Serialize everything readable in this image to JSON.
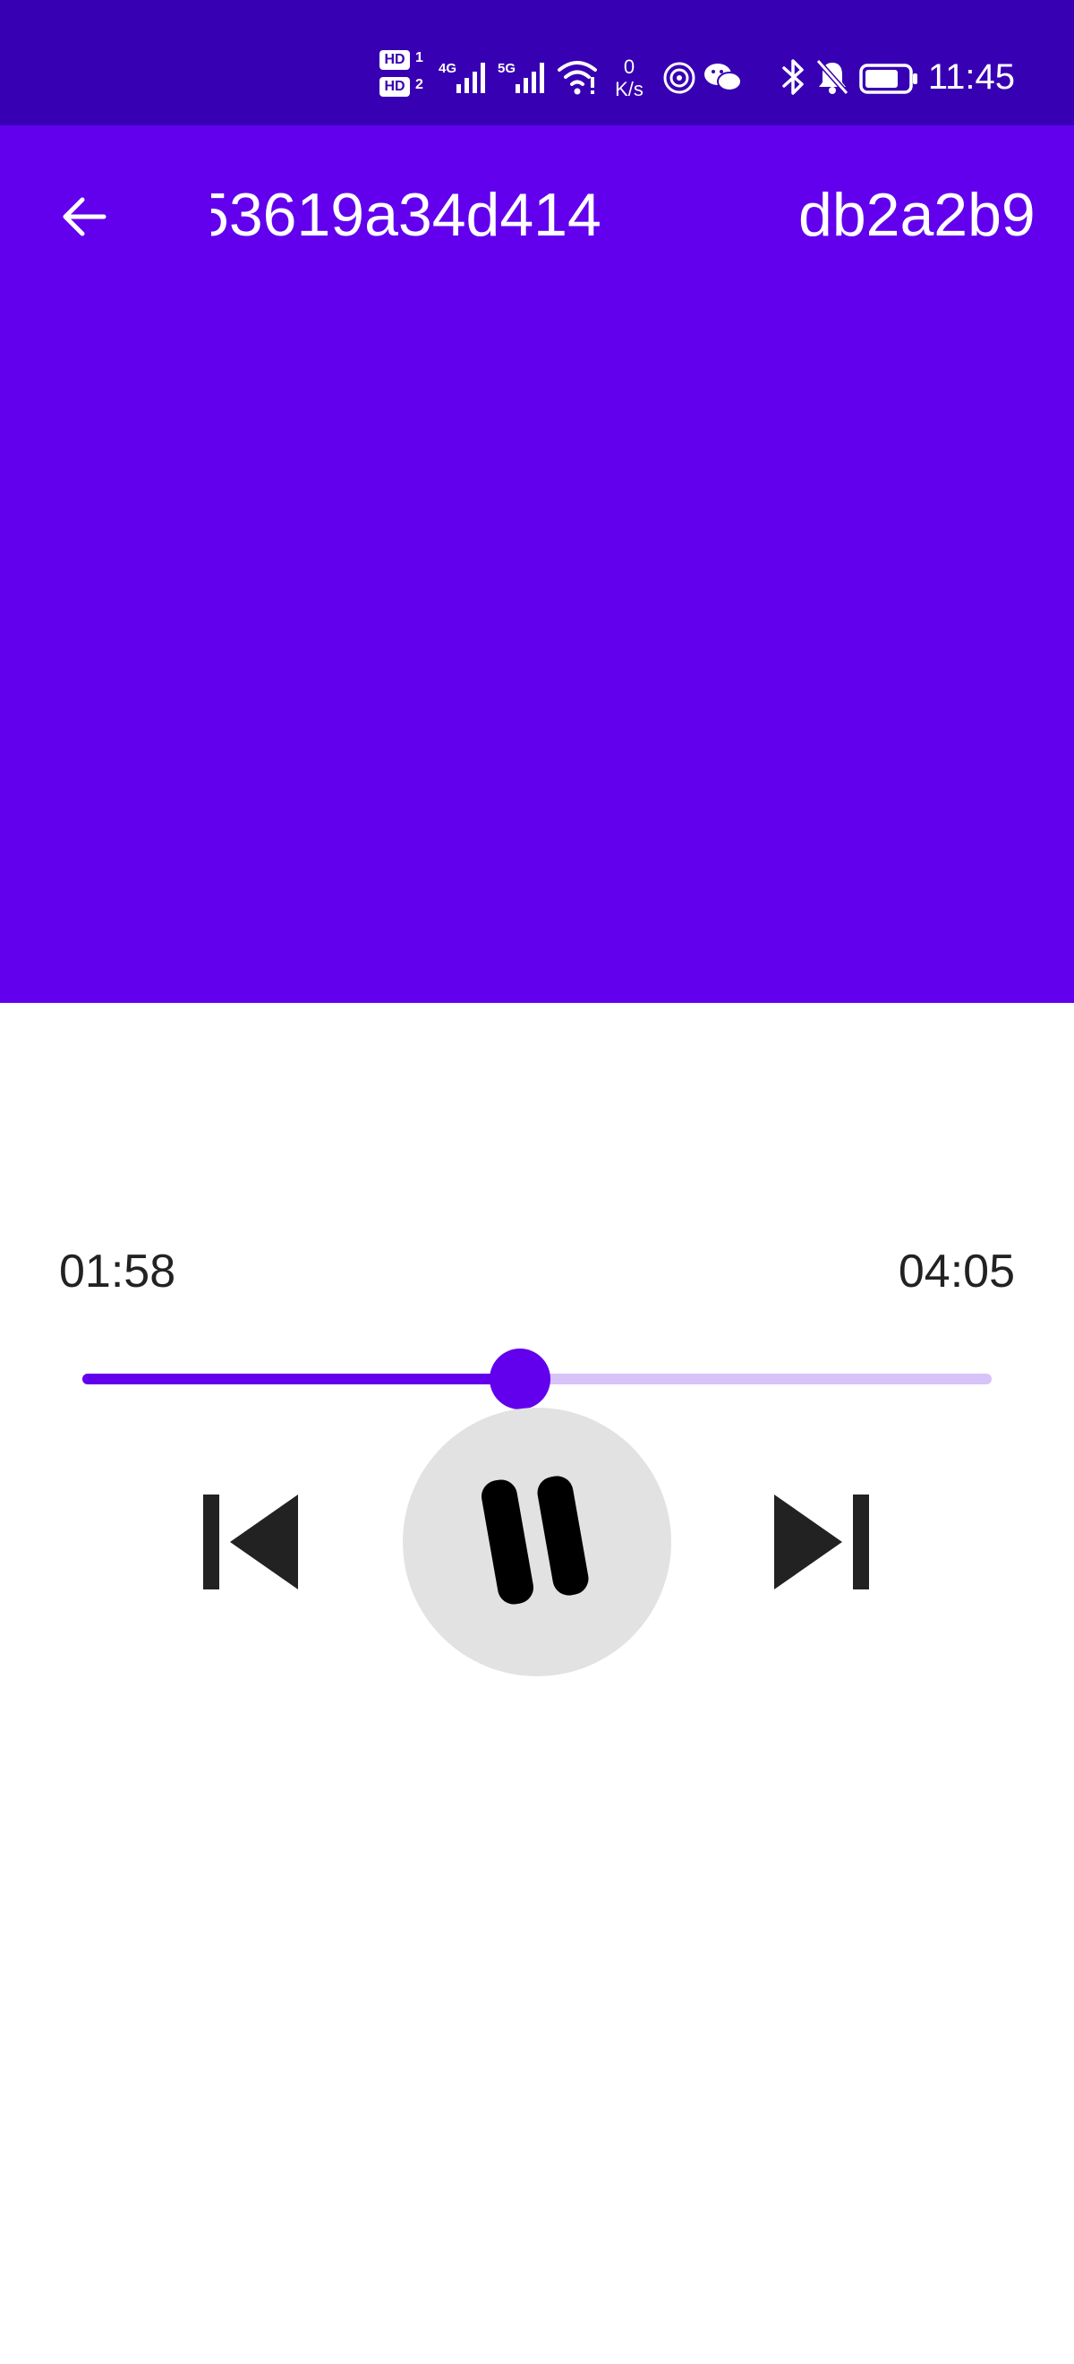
{
  "status_bar": {
    "hd_badge_1": "HD",
    "hd_badge_2": "HD",
    "sim_1": "1",
    "sim_2": "2",
    "network_1": "4G",
    "network_2": "5G",
    "speed_value": "0",
    "speed_unit": "K/s",
    "time": "11:45",
    "icons": [
      "signal-icon",
      "wifi-icon",
      "nfc-icon",
      "wechat-icon",
      "bluetooth-icon",
      "bell-muted-icon",
      "battery-icon"
    ]
  },
  "header": {
    "title_visible_left": "53619a34d414",
    "title_visible_right": "db2a2b9",
    "back_icon": "arrow-left-icon"
  },
  "player": {
    "elapsed": "01:58",
    "total": "04:05",
    "progress_fraction": 0.4816,
    "prev_icon": "skip-previous-icon",
    "play_pause_icon": "pause-icon",
    "next_icon": "skip-next-icon"
  },
  "colors": {
    "status_bar": "#3700B3",
    "primary": "#6200EE",
    "track_inactive": "#D7C2F9",
    "play_button_bg": "#E2E2E2",
    "icon_dark": "#222222"
  }
}
